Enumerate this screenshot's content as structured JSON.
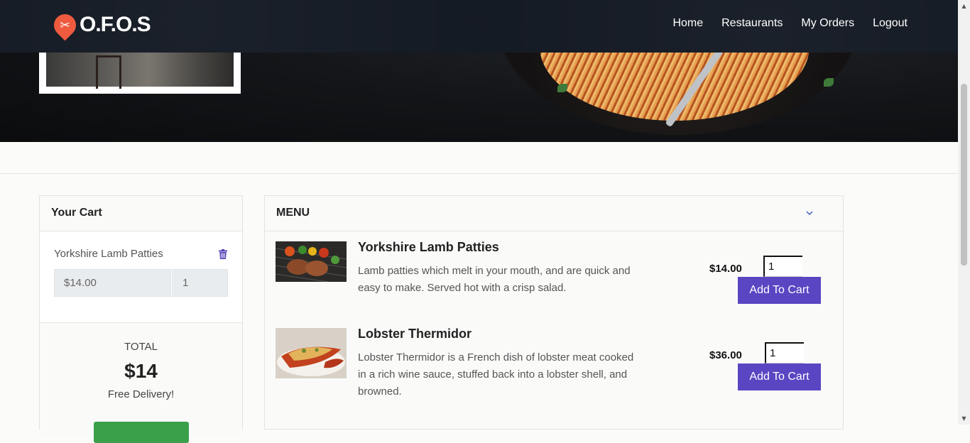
{
  "brand": {
    "name": "O.F.O.S",
    "logo_icon": "fork-knife-pin-icon",
    "accent": "#ee5b3f"
  },
  "nav": {
    "items": [
      "Home",
      "Restaurants",
      "My Orders",
      "Logout"
    ]
  },
  "cart": {
    "title": "Your Cart",
    "items": [
      {
        "name": "Yorkshire Lamb Patties",
        "price": "$14.00",
        "qty": "1"
      }
    ],
    "total_label": "TOTAL",
    "total": "$14",
    "delivery": "Free Delivery!"
  },
  "menu": {
    "title": "MENU",
    "dishes": [
      {
        "name": "Yorkshire Lamb Patties",
        "description": "Lamb patties which melt in your mouth, and are quick and easy to make. Served hot with a crisp salad.",
        "price": "$14.00",
        "qty": "1",
        "button": "Add To Cart"
      },
      {
        "name": "Lobster Thermidor",
        "description": "Lobster Thermidor is a French dish of lobster meat cooked in a rich wine sauce, stuffed back into a lobster shell, and browned.",
        "price": "$36.00",
        "qty": "1",
        "button": "Add To Cart"
      }
    ]
  },
  "colors": {
    "primary_button": "#5a45c2",
    "checkout": "#3aa14a",
    "nav_bg": "#141a24"
  }
}
